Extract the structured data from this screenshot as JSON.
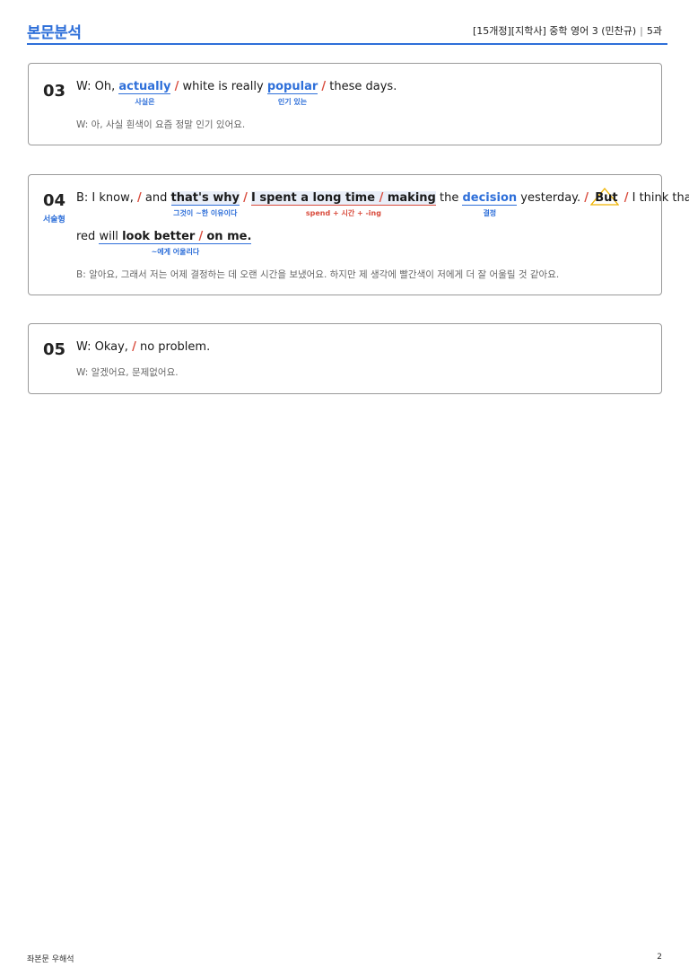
{
  "header": {
    "title": "본문분석",
    "course": "[15개정][지학사] 중학 영어 3 (민찬규)",
    "lesson": "5과"
  },
  "items": [
    {
      "number": "03",
      "speaker": "W: Oh,",
      "w_actually": "actually",
      "n_actually": "사실은",
      "w_middle": "white is really",
      "w_popular": "popular",
      "n_popular": "인기 있는",
      "w_end": "these days.",
      "translation": "W: 아, 사실 흰색이 요즘 정말 인기 있어요."
    },
    {
      "number": "04",
      "tag": "서술형",
      "speaker": "B: I know,",
      "w_and": "and",
      "w_thats_why": "that's why",
      "n_thats_why": "그것이 ~한 이유이다",
      "w_spent": "I spent a long time",
      "w_making": "making",
      "n_spend": "spend + 시간 + -ing",
      "w_the": "the",
      "w_decision": "decision",
      "n_decision": "결정",
      "w_yesterday": "yesterday.",
      "w_but": "But",
      "w_i_think": "I think that",
      "w_red": "red",
      "w_will": "will",
      "w_look_better": "look better",
      "n_look_better": "~에게 어울리다",
      "w_on_me": "on me.",
      "translation": "B: 알아요, 그래서 저는 어제 결정하는 데 오랜 시간을 보냈어요. 하지만 제 생각에 빨간색이 저에게 더 잘 어울릴 것 같아요."
    },
    {
      "number": "05",
      "speaker": "W: Okay,",
      "w_end": "no problem.",
      "translation": "W: 알겠어요, 문제없어요."
    }
  ],
  "footer": {
    "left": "좌본문 우해석",
    "page": "2"
  },
  "colors": {
    "accent": "#2e6fd9",
    "slash": "#d94c3d",
    "highlight": "#e9eef8",
    "warning_triangle": "#f0b400"
  }
}
